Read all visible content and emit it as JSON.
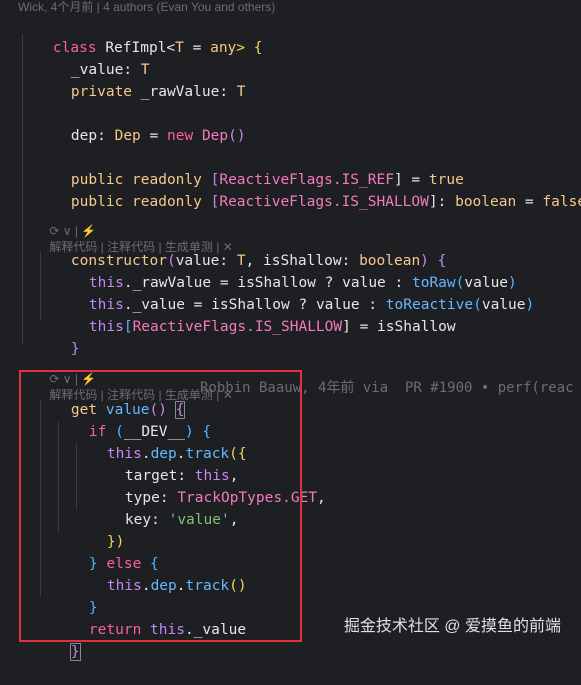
{
  "header": {
    "blame_summary": "Wick, 4个月前 | 4 authors (Evan You and others)"
  },
  "inlay_hint": {
    "icons": "⟳ ∨ | ⚡",
    "actions": "解释代码 | 注释代码 | 生成单测 | ✕"
  },
  "code": {
    "l1": [
      "class",
      " ",
      "RefImpl",
      "<",
      "T",
      " = ",
      "any",
      "> {"
    ],
    "l2": [
      "_value",
      ": ",
      "T"
    ],
    "l3": [
      "private",
      " _rawValue: ",
      "T"
    ],
    "l5": [
      "dep",
      ": ",
      "Dep",
      " = ",
      "new",
      " ",
      "Dep",
      "()"
    ],
    "l7": [
      "public readonly",
      " [",
      "ReactiveFlags",
      ".",
      "IS_REF",
      "] = ",
      "true"
    ],
    "l8": [
      "public readonly",
      " [",
      "ReactiveFlags",
      ".",
      "IS_SHALLOW",
      "]: ",
      "boolean",
      " = ",
      "false"
    ],
    "l10": [
      "constructor",
      "(",
      "value",
      ": ",
      "T",
      ", ",
      "isShallow",
      ": ",
      "boolean",
      ") {"
    ],
    "l11": [
      "this",
      "._rawValue = ",
      "isShallow",
      " ? ",
      "value",
      " : ",
      "toRaw",
      "(",
      "value",
      ")"
    ],
    "l12": [
      "this",
      "._value = ",
      "isShallow",
      " ? ",
      "value",
      " : ",
      "toReactive",
      "(",
      "value",
      ")"
    ],
    "l13": [
      "this",
      "[",
      "ReactiveFlags",
      ".",
      "IS_SHALLOW",
      "] = ",
      "isShallow"
    ],
    "l14": [
      "}"
    ],
    "l16": [
      "get",
      " ",
      "value",
      "() ",
      "{"
    ],
    "l17": [
      "if",
      " (",
      "__DEV__",
      ") {"
    ],
    "l18": [
      "this",
      ".",
      "dep",
      ".",
      "track",
      "({"
    ],
    "l19": [
      "target",
      ": ",
      "this",
      ","
    ],
    "l20": [
      "type",
      ": ",
      "TrackOpTypes",
      ".",
      "GET",
      ","
    ],
    "l21": [
      "key",
      ": ",
      "'value'",
      ","
    ],
    "l22": [
      "})"
    ],
    "l23": [
      "} ",
      "else",
      " {"
    ],
    "l24": [
      "this",
      ".",
      "dep",
      ".",
      "track",
      "()"
    ],
    "l25": [
      "}"
    ],
    "l26": [
      "return",
      " ",
      "this",
      "._value"
    ],
    "l27": [
      "}"
    ]
  },
  "blame_inline": "Robbin Baauw, 4年前 via  PR #1900 • perf(reac",
  "watermark": "掘金技术社区 @ 爱摸鱼的前端"
}
